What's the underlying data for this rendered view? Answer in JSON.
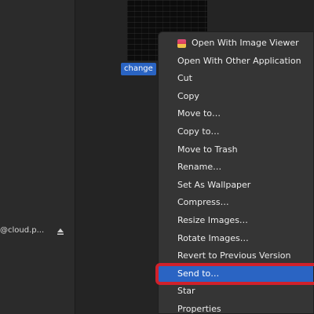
{
  "sidebar": {
    "account_label": "@cloud.p..."
  },
  "file": {
    "name": "change"
  },
  "context_menu": {
    "items": [
      "Open With Image Viewer",
      "Open With Other Application",
      "Cut",
      "Copy",
      "Move to…",
      "Copy to…",
      "Move to Trash",
      "Rename…",
      "Set As Wallpaper",
      "Compress…",
      "Resize Images…",
      "Rotate Images…",
      "Revert to Previous Version",
      "Send to…",
      "Star",
      "Properties"
    ],
    "highlighted_index": 13
  },
  "colors": {
    "selection": "#2a64c3",
    "annotation_box": "#d0212b"
  }
}
